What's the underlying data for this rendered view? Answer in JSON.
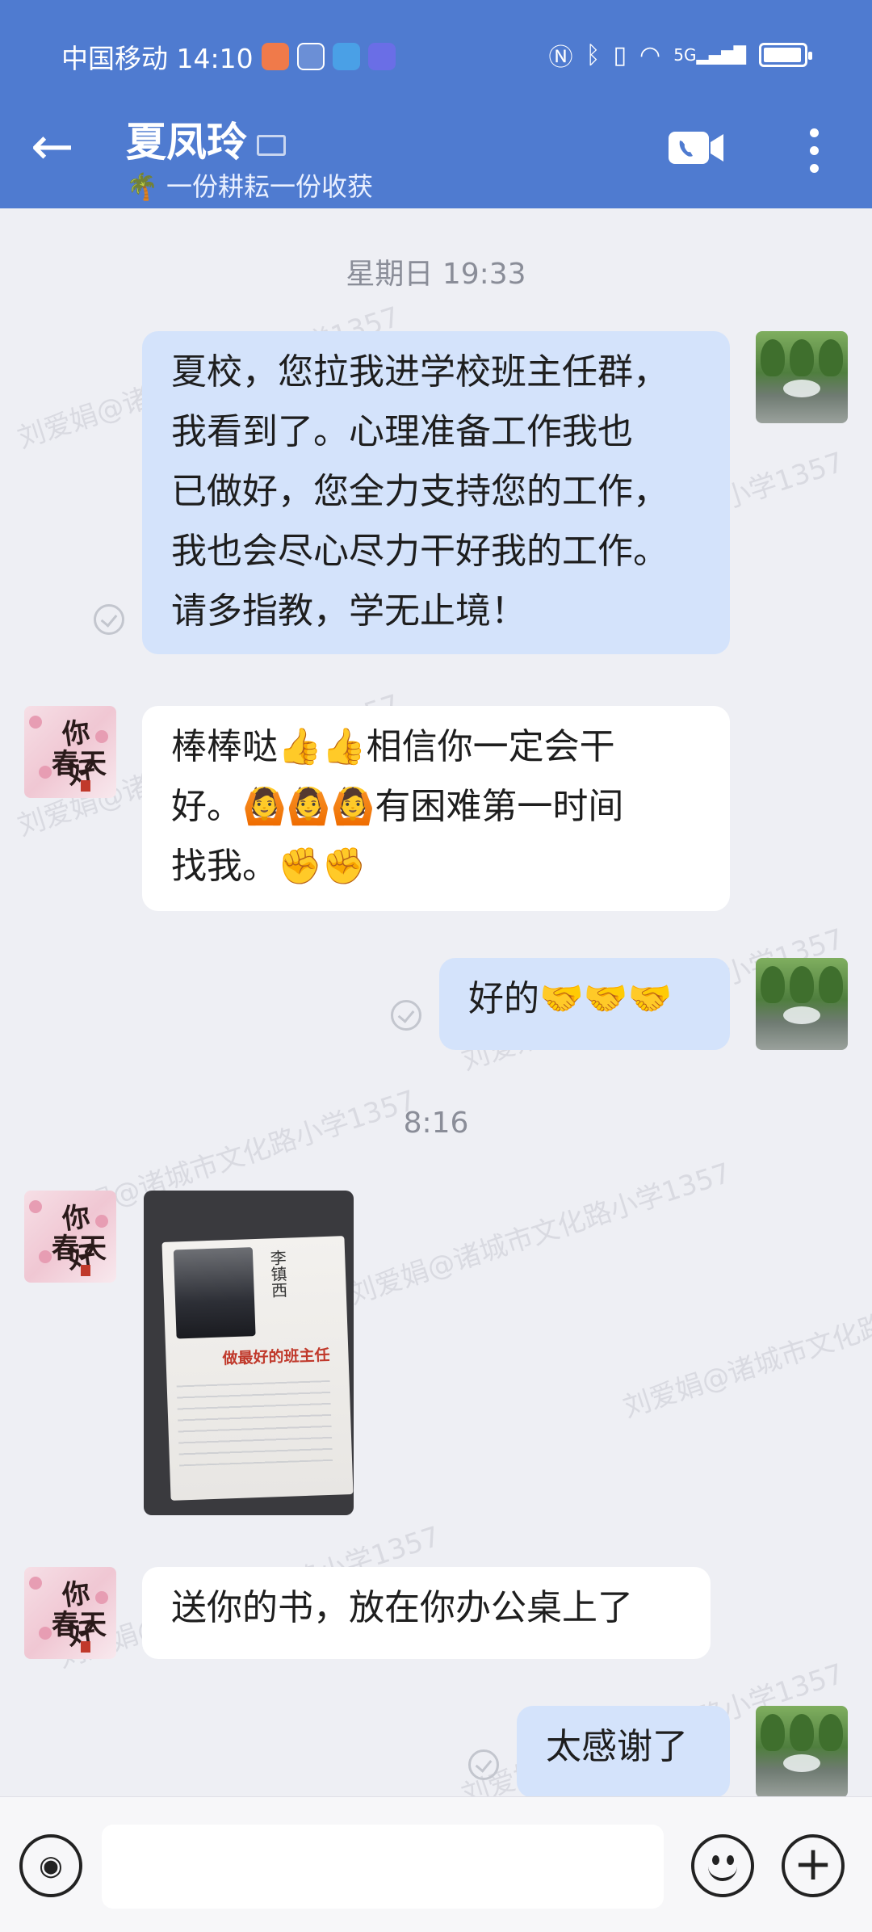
{
  "status_bar": {
    "carrier_time": "中国移动 14:10",
    "network": "5G"
  },
  "header": {
    "back_icon": "←",
    "contact_name": "夏凤玲",
    "signature": "🌴 一份耕耘一份收获",
    "video_call_icon": "video-camera-icon",
    "more_icon": "more-vertical-icon"
  },
  "watermark": "刘爱娟@诸城市文化路小学1357",
  "messages": {
    "time1": "星期日  19:33",
    "msg1": "夏校，您拉我进学校班主任群，\n我看到了。心理准备工作我也\n已做好，您全力支持您的工作，\n我也会尽心尽力干好我的工作。\n请多指教，学无止境！",
    "msg2": "棒棒哒👍👍相信你一定会干\n好。🙆🙆🙆有困难第一时间\n找我。✊✊",
    "msg3": "好的🤝🤝🤝",
    "time2": "8:16",
    "photo_book_title": "做最好的班主任",
    "photo_book_author": "李镇西",
    "msg5": "送你的书，放在你办公桌上了",
    "msg6": "太感谢了"
  },
  "avatars": {
    "spring_text1": "你好",
    "spring_text2": "春天"
  },
  "input": {
    "value": ""
  },
  "colors": {
    "header_bg": "#4f7bd0",
    "out_bubble": "#d4e3fb",
    "in_bubble": "#ffffff",
    "chat_bg": "#eeeff4"
  }
}
